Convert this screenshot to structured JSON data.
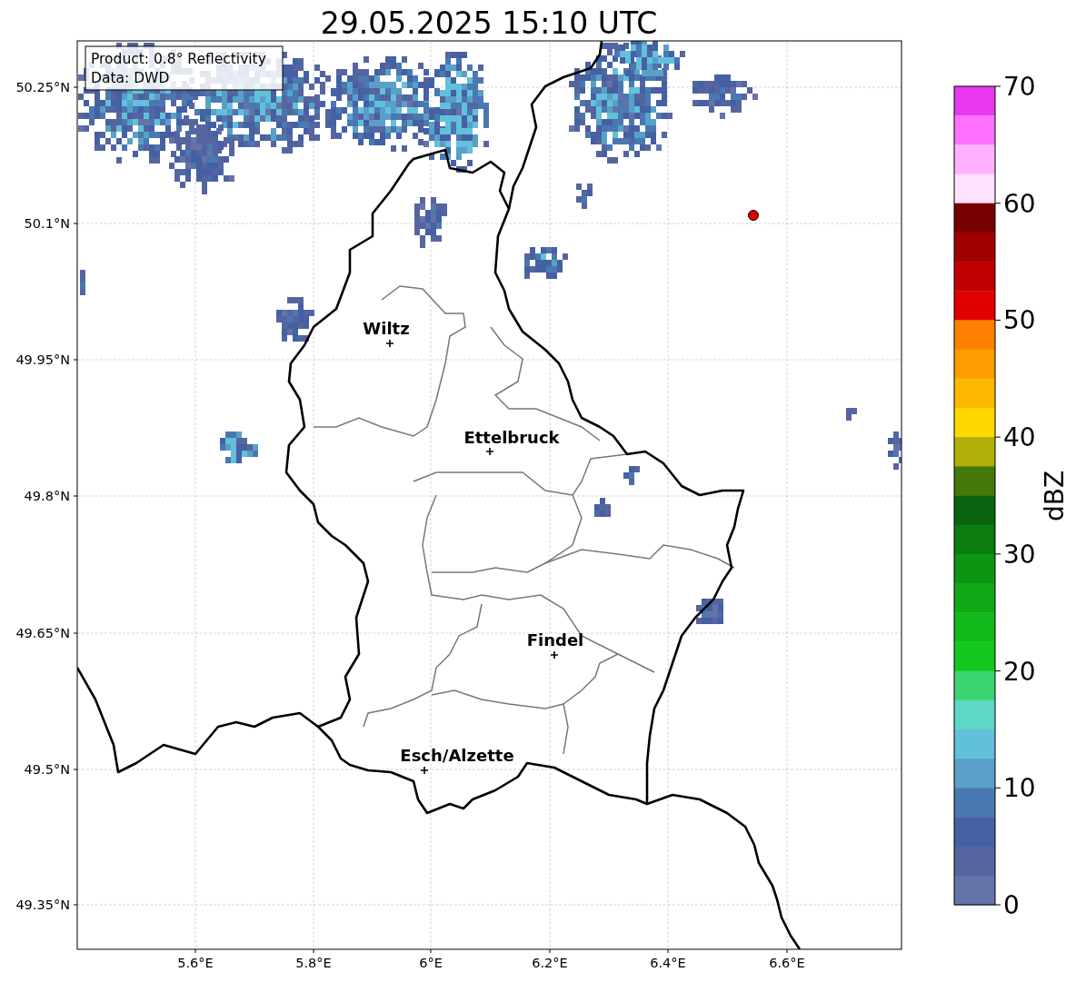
{
  "title": "29.05.2025 15:10 UTC",
  "info_box": [
    "Product: 0.8° Reflectivity",
    "Data: DWD"
  ],
  "x_ticks": [
    "5.6°E",
    "5.8°E",
    "6°E",
    "6.2°E",
    "6.4°E",
    "6.6°E"
  ],
  "y_ticks": [
    "50.25°N",
    "50.1°N",
    "49.95°N",
    "49.8°N",
    "49.65°N",
    "49.5°N",
    "49.35°N"
  ],
  "cities": [
    {
      "name": "Wiltz"
    },
    {
      "name": "Ettelbruck"
    },
    {
      "name": "Findel"
    },
    {
      "name": "Esch/Alzette"
    }
  ],
  "colorbar": {
    "label": "dBZ",
    "ticks": [
      "70",
      "60",
      "50",
      "40",
      "30",
      "20",
      "10",
      "0"
    ],
    "bins": [
      {
        "color": "#e838f0"
      },
      {
        "color": "#ff70ff"
      },
      {
        "color": "#ffb0ff"
      },
      {
        "color": "#ffe0ff"
      },
      {
        "color": "#780000"
      },
      {
        "color": "#a00000"
      },
      {
        "color": "#c00000"
      },
      {
        "color": "#e00000"
      },
      {
        "color": "#ff8000"
      },
      {
        "color": "#ff9c00"
      },
      {
        "color": "#ffb800"
      },
      {
        "color": "#ffd800"
      },
      {
        "color": "#b0b008"
      },
      {
        "color": "#447808"
      },
      {
        "color": "#08640e"
      },
      {
        "color": "#0a7c10"
      },
      {
        "color": "#0c9412"
      },
      {
        "color": "#0ea814"
      },
      {
        "color": "#10b81a"
      },
      {
        "color": "#12c81e"
      },
      {
        "color": "#3cd470"
      },
      {
        "color": "#5ed8c6"
      },
      {
        "color": "#62c0da"
      },
      {
        "color": "#58a0c8"
      },
      {
        "color": "#4a78b0"
      },
      {
        "color": "#4560a3"
      },
      {
        "color": "#55659f"
      },
      {
        "color": "#6573a8"
      }
    ]
  }
}
